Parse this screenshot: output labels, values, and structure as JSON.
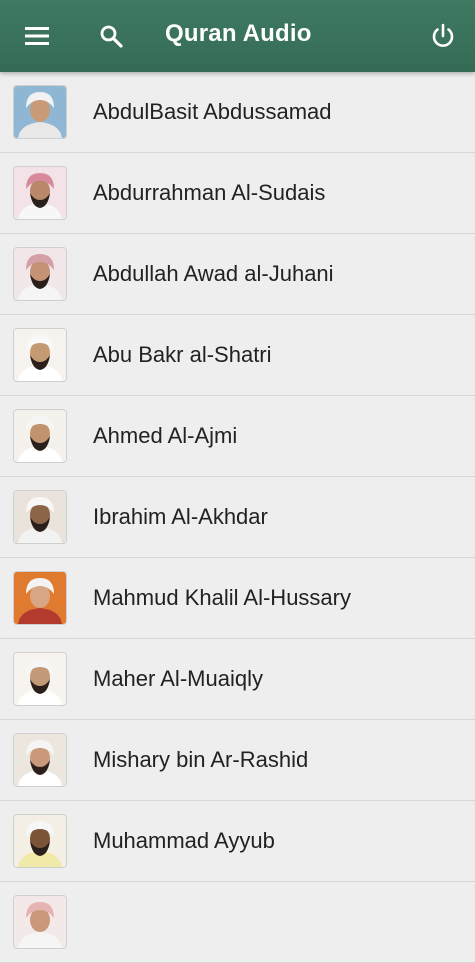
{
  "header": {
    "title": "Quran Audio",
    "menu_icon": "menu-icon",
    "search_icon": "search-icon",
    "power_icon": "power-icon",
    "color": "#3a7460"
  },
  "reciters": [
    {
      "name": "AbdulBasit Abdussamad",
      "bg": "#8fb7d4",
      "robe": "#e8e8e8",
      "head": "#f2f2f2",
      "skin": "#c99a78",
      "beard": false
    },
    {
      "name": "Abdurrahman Al-Sudais",
      "bg": "#f3e3e8",
      "robe": "#f7f7f7",
      "head": "#d88a9a",
      "skin": "#b98868",
      "beard": true
    },
    {
      "name": "Abdullah Awad al-Juhani",
      "bg": "#f1e6e8",
      "robe": "#f5f5f5",
      "head": "#d4a0a8",
      "skin": "#c59276",
      "beard": true
    },
    {
      "name": "Abu Bakr al-Shatri",
      "bg": "#f6f3ee",
      "robe": "#ffffff",
      "head": "#f8f8f8",
      "skin": "#c49a72",
      "beard": true
    },
    {
      "name": "Ahmed Al-Ajmi",
      "bg": "#f4f1ec",
      "robe": "#ffffff",
      "head": "#f5f5f5",
      "skin": "#c2936f",
      "beard": true
    },
    {
      "name": "Ibrahim Al-Akhdar",
      "bg": "#e9e3dc",
      "robe": "#f2f2f2",
      "head": "#f7f7f7",
      "skin": "#8c6448",
      "beard": true
    },
    {
      "name": "Mahmud Khalil Al-Hussary",
      "bg": "#e07a2e",
      "robe": "#b23b2e",
      "head": "#f3f3f3",
      "skin": "#d8a585",
      "beard": false
    },
    {
      "name": "Maher Al-Muaiqly",
      "bg": "#f7f4ef",
      "robe": "#ffffff",
      "head": "#f6f6f6",
      "skin": "#c39a78",
      "beard": true
    },
    {
      "name": "Mishary bin Ar-Rashid",
      "bg": "#ece6df",
      "robe": "#ffffff",
      "head": "#f5f5f5",
      "skin": "#c9997a",
      "beard": true
    },
    {
      "name": "Muhammad Ayyub",
      "bg": "#f3efe4",
      "robe": "#f1e9a8",
      "head": "#f7f7f7",
      "skin": "#7a5338",
      "beard": true
    },
    {
      "name": "",
      "bg": "#f3e9e9",
      "robe": "#f5f5f5",
      "head": "#e6b3b3",
      "skin": "#c9997a",
      "beard": false
    }
  ]
}
